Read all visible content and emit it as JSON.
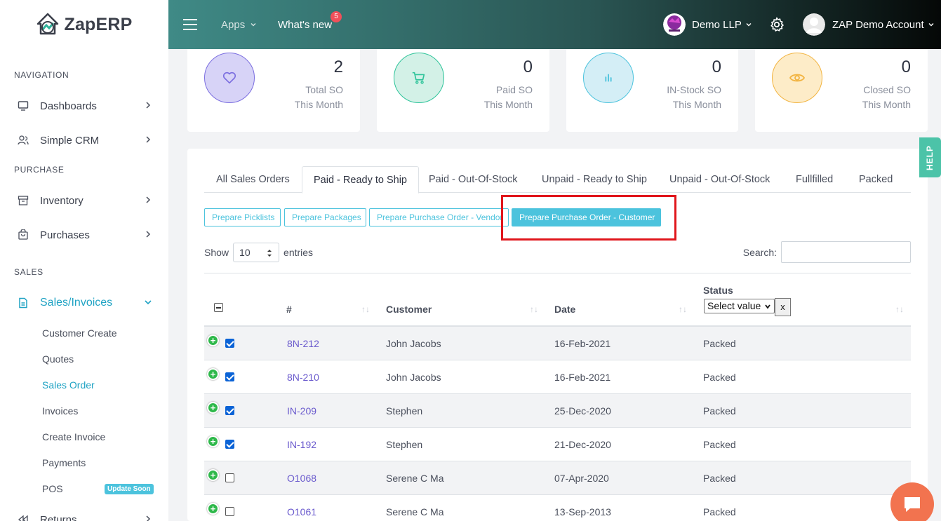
{
  "brand": {
    "name": "ZapERP"
  },
  "topbar": {
    "apps_label": "Apps",
    "whats_new_label": "What's new",
    "notification_count": "5",
    "company_label": "Demo LLP",
    "account_label": "ZAP Demo Account"
  },
  "sidebar": {
    "section_navigation": "NAVIGATION",
    "section_purchase": "PURCHASE",
    "section_sales": "SALES",
    "items": {
      "dashboards": "Dashboards",
      "simple_crm": "Simple CRM",
      "inventory": "Inventory",
      "purchases": "Purchases",
      "sales_invoices": "Sales/Invoices",
      "returns": "Returns"
    },
    "sub_items": [
      "Customer Create",
      "Quotes",
      "Sales Order",
      "Invoices",
      "Create Invoice",
      "Payments",
      "POS"
    ],
    "active_sub_item": "Sales Order",
    "pos_badge": "Update Soon"
  },
  "stats": [
    {
      "value": "2",
      "label1": "Total SO",
      "label2": "This Month",
      "icon": "heart-icon",
      "color": "#7b6ee0"
    },
    {
      "value": "0",
      "label1": "Paid SO",
      "label2": "This Month",
      "icon": "cart-icon",
      "color": "#2ec49a"
    },
    {
      "value": "0",
      "label1": "IN-Stock SO",
      "label2": "This Month",
      "icon": "bar-chart-icon",
      "color": "#4cc3dd"
    },
    {
      "value": "0",
      "label1": "Closed SO",
      "label2": "This Month",
      "icon": "eye-icon",
      "color": "#f2b441"
    }
  ],
  "tabs": [
    "All Sales Orders",
    "Paid - Ready to Ship",
    "Paid - Out-Of-Stock",
    "Unpaid - Ready to Ship",
    "Unpaid - Out-Of-Stock",
    "Fullfilled",
    "Packed"
  ],
  "active_tab": "Paid - Ready to Ship",
  "actions": {
    "picklists": "Prepare Picklists",
    "packages": "Prepare Packages",
    "po_vendor": "Prepare Purchase Order - Vendor",
    "po_customer": "Prepare Purchase Order - Customer"
  },
  "table_controls": {
    "show_label": "Show",
    "entries_value": "10",
    "entries_label": "entries",
    "search_label": "Search:",
    "search_value": ""
  },
  "table": {
    "columns": {
      "number": "#",
      "customer": "Customer",
      "date": "Date",
      "status": "Status"
    },
    "status_filter": "Select value",
    "clear_filter": "x",
    "rows": [
      {
        "number": "8N-212",
        "customer": "John Jacobs",
        "date": "16-Feb-2021",
        "status": "Packed",
        "checked": true
      },
      {
        "number": "8N-210",
        "customer": "John Jacobs",
        "date": "16-Feb-2021",
        "status": "Packed",
        "checked": true
      },
      {
        "number": "IN-209",
        "customer": "Stephen",
        "date": "25-Dec-2020",
        "status": "Packed",
        "checked": true
      },
      {
        "number": "IN-192",
        "customer": "Stephen",
        "date": "21-Dec-2020",
        "status": "Packed",
        "checked": true
      },
      {
        "number": "O1068",
        "customer": "Serene C Ma",
        "date": "07-Apr-2020",
        "status": "Packed",
        "checked": false
      },
      {
        "number": "O1061",
        "customer": "Serene C Ma",
        "date": "13-Sep-2013",
        "status": "Packed",
        "checked": false
      }
    ]
  },
  "help_label": "HELP"
}
